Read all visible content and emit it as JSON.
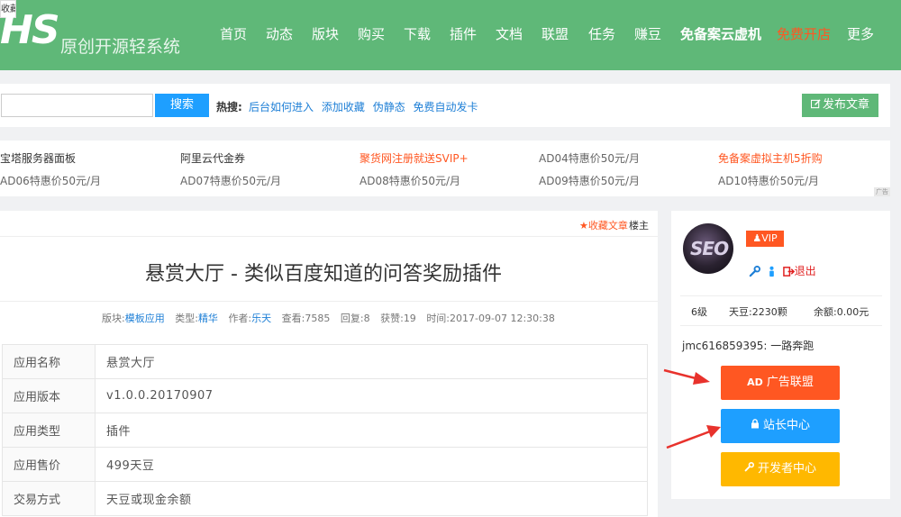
{
  "header": {
    "fav_tab": "收藏夹",
    "logo_mark": "HS",
    "logo_sub": "原创开源轻系统",
    "nav": [
      {
        "label": "首页"
      },
      {
        "label": "动态"
      },
      {
        "label": "版块"
      },
      {
        "label": "购买"
      },
      {
        "label": "下载"
      },
      {
        "label": "插件"
      },
      {
        "label": "文档"
      },
      {
        "label": "联盟"
      },
      {
        "label": "任务"
      },
      {
        "label": "赚豆"
      },
      {
        "label": "免备案云虚机"
      },
      {
        "label": "免费开店"
      },
      {
        "label": "更多"
      }
    ]
  },
  "search": {
    "input_value": "",
    "button": "搜索",
    "hot_label": "热搜:",
    "hot_links": [
      "后台如何进入",
      "添加收藏",
      "伪静态",
      "免费自动发卡"
    ],
    "publish": "发布文章",
    "publish_icon": "edit-icon"
  },
  "ads": {
    "row1": [
      "宝塔服务器面板",
      "阿里云代金券",
      "聚货网注册就送SVIP+",
      "AD04特惠价50元/月",
      "免备案虚拟主机5折购"
    ],
    "row2": [
      "AD06特惠价50元/月",
      "AD07特惠价50元/月",
      "AD08特惠价50元/月",
      "AD09特惠价50元/月",
      "AD10特惠价50元/月"
    ],
    "badge": "广告",
    "highlight_color": "#ff5722"
  },
  "post": {
    "fav": "收藏文章",
    "owner": "楼主",
    "title": "悬赏大厅 - 类似百度知道的问答奖励插件",
    "meta": {
      "forum_label": "版块:",
      "forum": "模板应用",
      "type_label": "类型:",
      "type": "精华",
      "author_label": "作者:",
      "author": "乐天",
      "views_label": "查看:",
      "views": "7585",
      "replies_label": "回复:",
      "replies": "8",
      "likes_label": "获赞:",
      "likes": "19",
      "time_label": "时间:",
      "time": "2017-09-07 12:30:38"
    },
    "table": [
      {
        "k": "应用名称",
        "v": "悬赏大厅"
      },
      {
        "k": "应用版本",
        "v": "v1.0.0.20170907"
      },
      {
        "k": "应用类型",
        "v": "插件"
      },
      {
        "k": "应用售价",
        "v": "499天豆"
      },
      {
        "k": "交易方式",
        "v": "天豆或现金余额"
      }
    ]
  },
  "user": {
    "avatar_text": "SEO",
    "vip": "VIP",
    "logout": "退出",
    "level": "6级",
    "beans": "天豆:2230颗",
    "balance": "余额:0.00元",
    "signature": "jmc616859395: 一路奔跑",
    "btn_ad": "广告联盟",
    "btn_ad_icon": "AD",
    "btn_admin": "站长中心",
    "btn_dev": "开发者中心"
  },
  "colors": {
    "header_green": "#5fb878",
    "blue": "#1e9fff",
    "orange": "#ff5722",
    "yellow": "#ffb800",
    "arrow_red": "#e8322c"
  }
}
